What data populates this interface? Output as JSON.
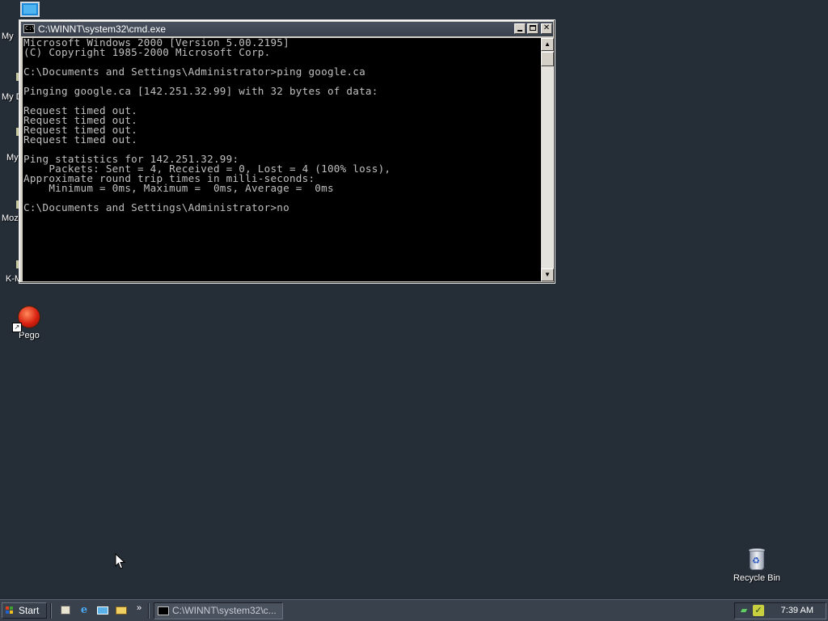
{
  "desktop": {
    "partial_labels": [
      "My",
      "My D",
      "My",
      "Moz",
      "K-M"
    ],
    "icons": [
      {
        "label": "Pego",
        "icon": "pego-red-ball-shortcut-icon"
      },
      {
        "label": "Recycle Bin",
        "icon": "recycle-bin-icon"
      }
    ]
  },
  "window": {
    "title": "C:\\WINNT\\system32\\cmd.exe",
    "console_text": "Microsoft Windows 2000 [Version 5.00.2195]\n(C) Copyright 1985-2000 Microsoft Corp.\n\nC:\\Documents and Settings\\Administrator>ping google.ca\n\nPinging google.ca [142.251.32.99] with 32 bytes of data:\n\nRequest timed out.\nRequest timed out.\nRequest timed out.\nRequest timed out.\n\nPing statistics for 142.251.32.99:\n    Packets: Sent = 4, Received = 0, Lost = 4 (100% loss),\nApproximate round trip times in milli-seconds:\n    Minimum = 0ms, Maximum =  0ms, Average =  0ms\n\nC:\\Documents and Settings\\Administrator>no"
  },
  "taskbar": {
    "start_label": "Start",
    "quick_launch": [
      "show-desktop-icon",
      "internet-explorer-icon",
      "outlook-express-icon",
      "windows-explorer-icon"
    ],
    "task_button_label": "C:\\WINNT\\system32\\c...",
    "clock": "7:39 AM"
  },
  "colors": {
    "desktop_bg": "#252d37",
    "taskbar_bg": "#39414d",
    "console_bg": "#000000",
    "console_fg": "#c0c0c0"
  }
}
